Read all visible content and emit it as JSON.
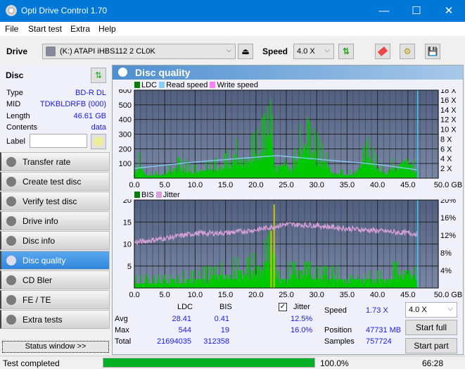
{
  "window": {
    "title": "Opti Drive Control 1.70",
    "minimize": "—",
    "maximize": "☐",
    "close": "✕"
  },
  "menu": [
    "File",
    "Start test",
    "Extra",
    "Help"
  ],
  "toolbar": {
    "drive_label": "Drive",
    "drive_value": "(K:)  ATAPI iHBS112  2 CL0K",
    "speed_label": "Speed",
    "speed_value": "4.0 X"
  },
  "disc": {
    "header": "Disc",
    "type_label": "Type",
    "type": "BD-R DL",
    "mid_label": "MID",
    "mid": "TDKBLDRFB (000)",
    "length_label": "Length",
    "length": "46.61 GB",
    "contents_label": "Contents",
    "contents": "data",
    "label_label": "Label",
    "label_value": ""
  },
  "nav": [
    {
      "label": "Transfer rate"
    },
    {
      "label": "Create test disc"
    },
    {
      "label": "Verify test disc"
    },
    {
      "label": "Drive info"
    },
    {
      "label": "Disc info"
    },
    {
      "label": "Disc quality",
      "active": true
    },
    {
      "label": "CD Bler"
    },
    {
      "label": "FE / TE"
    },
    {
      "label": "Extra tests"
    }
  ],
  "status_window_button": "Status window >>",
  "panel": {
    "title": "Disc quality"
  },
  "chart_data": [
    {
      "type": "bar",
      "title": "LDC",
      "legend": [
        "LDC",
        "Read speed",
        "Write speed"
      ],
      "colors": {
        "LDC": "#00c800",
        "Read speed": "#87cefa",
        "Write speed": "#ff80ff"
      },
      "x_ticks": [
        "0.0",
        "5.0",
        "10.0",
        "15.0",
        "20.0",
        "25.0",
        "30.0",
        "35.0",
        "40.0",
        "45.0",
        "50.0 GB"
      ],
      "y_ticks": [
        "100",
        "200",
        "300",
        "400",
        "500",
        "600"
      ],
      "y2_ticks": [
        "2 X",
        "4 X",
        "6 X",
        "8 X",
        "10 X",
        "12 X",
        "14 X",
        "16 X",
        "18 X"
      ],
      "xlim": [
        0,
        50
      ],
      "ylim": [
        0,
        600
      ],
      "y2lim": [
        0,
        18
      ],
      "ldc_profile": [
        [
          0,
          70
        ],
        [
          1,
          200
        ],
        [
          2,
          40
        ],
        [
          5,
          50
        ],
        [
          7,
          150
        ],
        [
          10,
          90
        ],
        [
          13,
          130
        ],
        [
          15,
          170
        ],
        [
          16.5,
          280
        ],
        [
          18,
          230
        ],
        [
          20,
          330
        ],
        [
          21.5,
          450
        ],
        [
          22.5,
          540
        ],
        [
          23.3,
          80
        ],
        [
          24,
          300
        ],
        [
          26,
          110
        ],
        [
          27,
          350
        ],
        [
          28,
          440
        ],
        [
          30,
          320
        ],
        [
          33,
          60
        ],
        [
          36,
          60
        ],
        [
          38.5,
          280
        ],
        [
          41,
          70
        ],
        [
          45,
          250
        ],
        [
          46.6,
          50
        ]
      ],
      "read_speed": [
        [
          0,
          2.0
        ],
        [
          10,
          3.3
        ],
        [
          20,
          4.3
        ],
        [
          23.5,
          4.6
        ],
        [
          30,
          3.9
        ],
        [
          40,
          2.8
        ],
        [
          46.6,
          1.7
        ]
      ],
      "end_position_gb": 46.61
    },
    {
      "type": "bar",
      "title": "BIS / Jitter",
      "legend": [
        "BIS",
        "Jitter"
      ],
      "colors": {
        "BIS": "#00c800",
        "Jitter": "#d8a0d8"
      },
      "x_ticks": [
        "0.0",
        "5.0",
        "10.0",
        "15.0",
        "20.0",
        "25.0",
        "30.0",
        "35.0",
        "40.0",
        "45.0",
        "50.0 GB"
      ],
      "y_ticks": [
        "5",
        "10",
        "15",
        "20"
      ],
      "y2_ticks": [
        "4%",
        "8%",
        "12%",
        "16%",
        "20%"
      ],
      "xlim": [
        0,
        50
      ],
      "ylim": [
        0,
        20
      ],
      "y2lim": [
        0,
        20
      ],
      "bis_profile": [
        [
          0,
          3
        ],
        [
          5,
          3
        ],
        [
          10,
          4
        ],
        [
          15,
          6
        ],
        [
          20,
          8
        ],
        [
          22,
          12
        ],
        [
          23,
          19
        ],
        [
          23.5,
          4
        ],
        [
          27,
          7
        ],
        [
          30,
          5
        ],
        [
          40,
          4
        ],
        [
          45.5,
          8
        ],
        [
          46.6,
          3
        ]
      ],
      "jitter": [
        [
          0,
          10.3
        ],
        [
          5,
          11.3
        ],
        [
          10,
          12.4
        ],
        [
          15,
          12.5
        ],
        [
          20,
          13.2
        ],
        [
          25,
          14.5
        ],
        [
          30,
          14.2
        ],
        [
          35,
          13.5
        ],
        [
          40,
          13.0
        ],
        [
          46.6,
          12.3
        ]
      ]
    }
  ],
  "stats": {
    "col_ldc": "LDC",
    "col_bis": "BIS",
    "jitter_label": "Jitter",
    "jitter_checked": true,
    "avg_label": "Avg",
    "avg_ldc": "28.41",
    "avg_bis": "0.41",
    "avg_jitter": "12.5%",
    "max_label": "Max",
    "max_ldc": "544",
    "max_bis": "19",
    "max_jitter": "16.0%",
    "total_label": "Total",
    "total_ldc": "21694035",
    "total_bis": "312358",
    "speed_label": "Speed",
    "speed": "1.73 X",
    "position_label": "Position",
    "position": "47731 MB",
    "samples_label": "Samples",
    "samples": "757724",
    "speed_select": "4.0 X",
    "start_full": "Start full",
    "start_part": "Start part"
  },
  "statusbar": {
    "text": "Test completed",
    "progress_pct": 100,
    "progress_text": "100.0%",
    "time": "66:28"
  }
}
